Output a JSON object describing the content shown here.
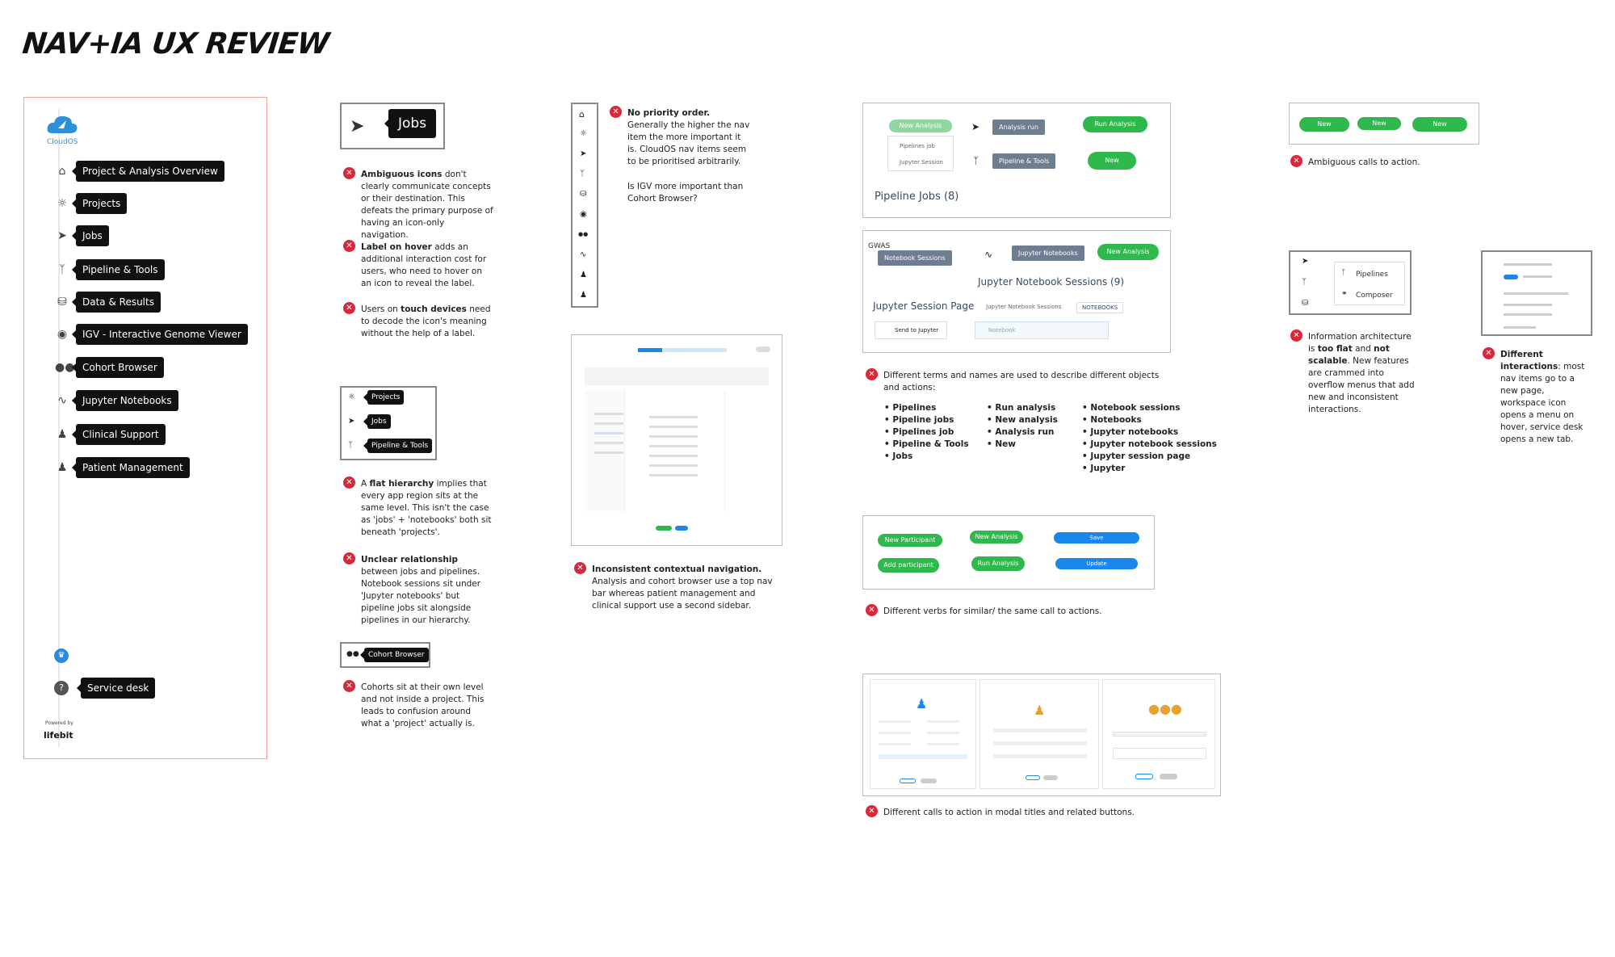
{
  "page": {
    "title": "NAV+IA UX REVIEW"
  },
  "sidebar": {
    "logo_text": "CloudOS",
    "items": [
      {
        "label": "Project & Analysis Overview",
        "icon": "home-icon"
      },
      {
        "label": "Projects",
        "icon": "lightbulb-icon"
      },
      {
        "label": "Jobs",
        "icon": "rocket-icon"
      },
      {
        "label": "Pipeline & Tools",
        "icon": "pipeline-icon"
      },
      {
        "label": "Data & Results",
        "icon": "database-icon"
      },
      {
        "label": "IGV - Interactive Genome Viewer",
        "icon": "genome-icon"
      },
      {
        "label": "Cohort Browser",
        "icon": "group-icon"
      },
      {
        "label": "Jupyter Notebooks",
        "icon": "jupyter-icon"
      },
      {
        "label": "Clinical Support",
        "icon": "doctor-icon"
      },
      {
        "label": "Patient Management",
        "icon": "person-icon"
      }
    ],
    "service_desk": "Service desk",
    "powered_by": "Powered by",
    "brand": "lifebit"
  },
  "col1": {
    "jobs_label": "Jobs",
    "n1_bold": "Ambiguous icons",
    "n1_rest": " don't clearly communicate concepts or their destination. This defeats the primary purpose of having an icon-only navigation.",
    "n2_bold": "Label on hover",
    "n2_rest": " adds an additional interaction cost for users, who need to hover on an icon to reveal the label.",
    "n3_a": "Users on ",
    "n3_bold": "touch devices",
    "n3_rest": " need to decode the icon's meaning without the help of a label.",
    "stack": [
      "Projects",
      "Jobs",
      "Pipeline & Tools"
    ],
    "n4_a": "A ",
    "n4_bold": "flat hierarchy",
    "n4_rest": " implies that every app region sits at the same level. This isn't the case as 'jobs' + 'notebooks' both sit beneath 'projects'.",
    "n5_bold": "Unclear relationship",
    "n5_rest": " between jobs and pipelines. Notebook sessions sit under 'Jupyter notebooks' but pipeline jobs sit alongside pipelines in our hierarchy.",
    "cohort_label": "Cohort Browser",
    "n6": "Cohorts sit at their own level and not inside a project. This leads to confusion around what a 'project' actually is."
  },
  "col2": {
    "n1_bold": "No priority order.",
    "n1_rest": " Generally the higher the nav item the more important it is. CloudOS nav items seem to be prioritised arbitrarily.",
    "n1_q": "Is IGV more important than Cohort Browser?",
    "n2_bold": "Inconsistent contextual navigation.",
    "n2_rest": " Analysis and cohort browser use a top nav bar whereas patient management and clinical support use a second sidebar."
  },
  "col3": {
    "new_analysis": "New Analysis",
    "analysis_run": "Analysis run",
    "run_analysis": "Run Analysis",
    "pipelines_job": "Pipelines job",
    "jupyter_session": "Jupyter Session",
    "pipeline_tools": "Pipeline & Tools",
    "new": "New",
    "pipeline_jobs": "Pipeline Jobs (8)",
    "gwas": "GWAS",
    "notebook_sessions": "Notebook Sessions",
    "jupyter_notebooks": "Jupyter Notebooks",
    "jupyter_notebook_sessions": "Jupyter Notebook Sessions (9)",
    "jupyter_session_page": "Jupyter Session Page",
    "jns_small": "Jupyter Notebook Sessions",
    "notebooks": "NOTEBOOKS",
    "send_to_jupyter": "Send to Jupyter",
    "notebook": "Notebook",
    "n1": "Different terms and names are used to describe different objects and actions:",
    "list1": [
      "Pipelines",
      "Pipeline jobs",
      "Pipelines job",
      "Pipeline & Tools",
      "Jobs"
    ],
    "list2": [
      "Run analysis",
      "New analysis",
      "Analysis run",
      "New"
    ],
    "list3": [
      "Notebook sessions",
      "Notebooks",
      "Jupyter notebooks",
      "Jupyter notebook sessions",
      "Jupyter session page",
      "Jupyter"
    ],
    "new_participant": "New Participant",
    "add_participant": "Add participant",
    "save": "Save",
    "update": "Update",
    "n2": "Different verbs for similar/ the same call to actions.",
    "n3": "Different calls to action in modal titles and related buttons."
  },
  "col4": {
    "new": "New",
    "n1": "Ambiguous calls to action.",
    "pipelines": "Pipelines",
    "composer": "Composer",
    "n2_a": "Information architecture is ",
    "n2_bold1": "too flat",
    "n2_mid": " and ",
    "n2_bold2": "not scalable",
    "n2_rest": ". New features are crammed into overflow menus that add new and inconsistent interactions.",
    "n3_bold": "Different interactions",
    "n3_rest": ": most nav items go to a new page, workspace icon opens a menu on hover, service desk opens a new tab."
  },
  "colors": {
    "accent_red": "#d8283a",
    "green": "#2fb84c",
    "blue": "#1b87ec",
    "panel_border": "#f2a19a"
  }
}
